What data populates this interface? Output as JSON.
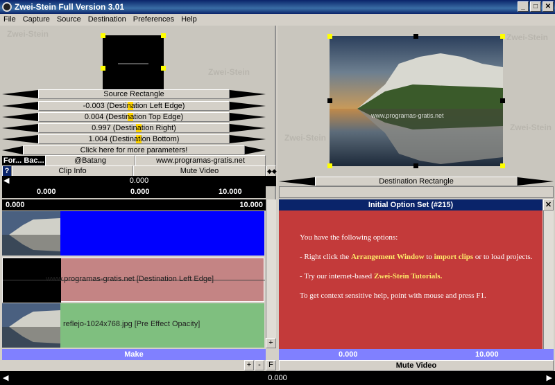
{
  "window": {
    "title": "Zwei-Stein Full Version 3.01",
    "min": "_",
    "max": "□",
    "close": "✕"
  },
  "menu": [
    "File",
    "Capture",
    "Source",
    "Destination",
    "Preferences",
    "Help"
  ],
  "watermark": "Zwei-Stein",
  "left_top": {
    "source_rect": "Source Rectangle",
    "params": [
      "-0.003 (Destination Left Edge)",
      "0.004 (Destination Top Edge)",
      "0.997 (Destination Right)",
      "1.004 (Destination Bottom)"
    ],
    "more_params": "Click here for more parameters!",
    "tab1": "For...",
    "tab2": "Bac...",
    "font_name": "@Batang",
    "site": "www.programas-gratis.net",
    "help_q": "?",
    "clip_info": "Clip Info",
    "mute_video": "Mute Video",
    "timeline_value": "0.000",
    "time_a": "0.000",
    "time_b": "0.000",
    "time_c": "10.000"
  },
  "right_top": {
    "dest_rect": "Destination Rectangle",
    "watermark_text": "www.programas-gratis.net",
    "center_watermark": "PROGRAMAS-GRATIS"
  },
  "left_bottom": {
    "scale_start": "0.000",
    "scale_end": "10.000",
    "track2_label": "www.programas-gratis.net [Destination Left Edge]",
    "track3_label": "reflejo-1024x768.jpg [Pre Effect Opacity]",
    "make": "Make",
    "plus": "+",
    "minus": "-",
    "f": "F"
  },
  "right_bottom": {
    "panel_title": "Initial Option Set (#215)",
    "close": "✕",
    "line1": "You have the following options:",
    "line2_pre": "- Right click the ",
    "line2_b1": "Arrangement Window",
    "line2_mid": " to ",
    "line2_b2": "import clips",
    "line2_post": " or to load projects.",
    "line3_pre": "- Try our internet-based ",
    "line3_b": "Zwei-Stein Tutorials.",
    "line4": "To get context sensitive help, point with mouse and press F1.",
    "time_a": "0.000",
    "time_b": "10.000",
    "mute_video": "Mute Video"
  },
  "bottom_bar": {
    "value": "0.000"
  },
  "colors": {
    "track_blue": "#0000ff",
    "track_pink": "#c48484",
    "track_green": "#7fbf7f",
    "info_red": "#c33a3a",
    "panel_navy": "#0a246a"
  }
}
